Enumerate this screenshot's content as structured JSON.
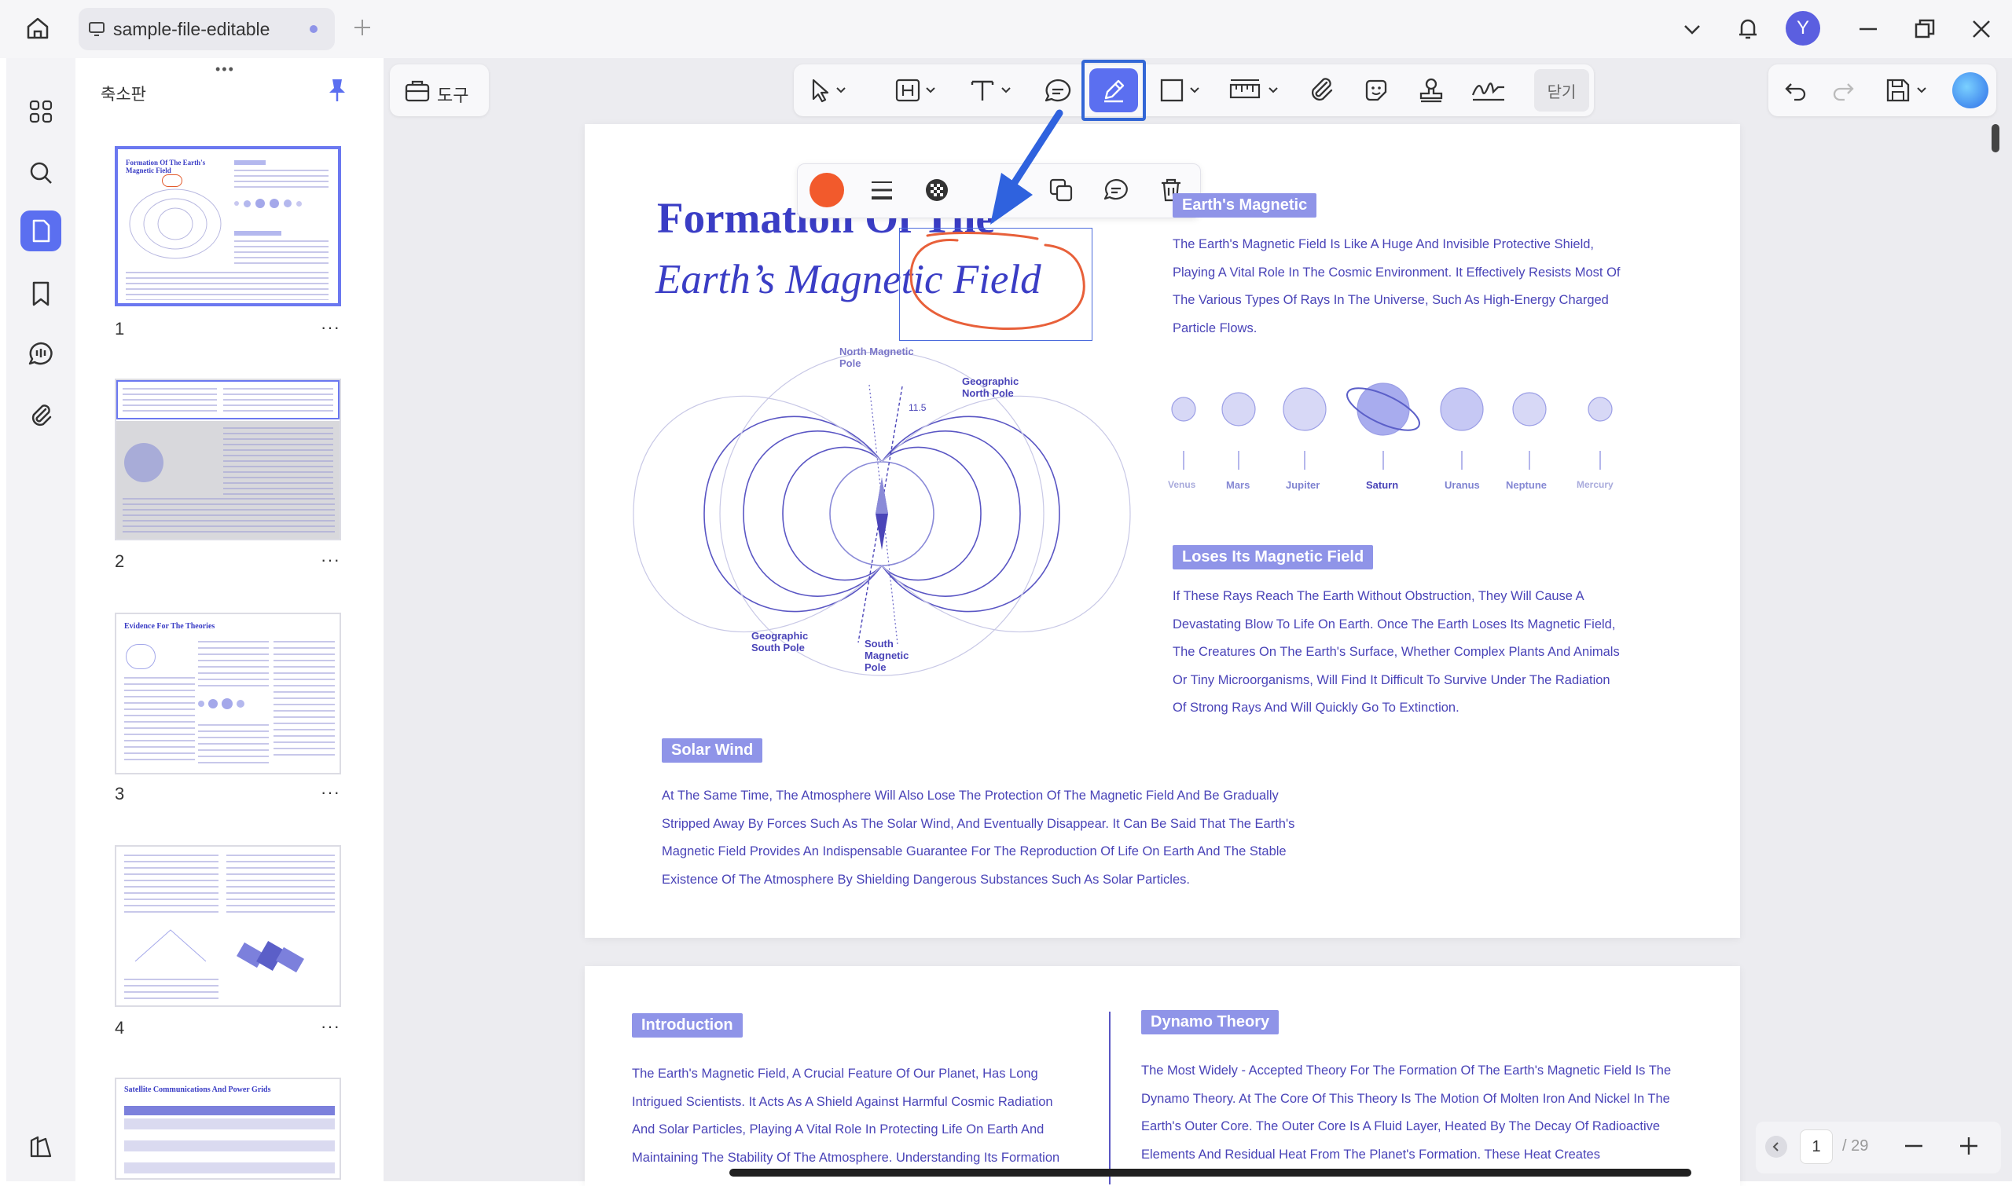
{
  "titlebar": {
    "tab_title": "sample-file-editable",
    "avatar_letter": "Y"
  },
  "thumbnails": {
    "panel_title": "축소판",
    "pages": [
      {
        "number": "1",
        "more": "···",
        "heading": "Formation Of The Earth's Magnetic Field"
      },
      {
        "number": "2",
        "more": "···"
      },
      {
        "number": "3",
        "more": "···",
        "heading": "Evidence For The Theories"
      },
      {
        "number": "4",
        "more": "···"
      },
      {
        "heading": "Satellite Communications And Power Grids"
      }
    ]
  },
  "toolbar": {
    "tools_label": "도구",
    "close_label": "닫기"
  },
  "annotation_bar": {
    "color": "#f25a2c"
  },
  "page1": {
    "title_line1": "Formation Of The",
    "title_line2": "Earth’s Magnetic Field",
    "section1_header": "Earth's Magnetic",
    "section1_text": "The Earth's Magnetic Field Is Like A Huge And Invisible Protective Shield, Playing A Vital Role In The Cosmic Environment. It Effectively Resists Most Of The Various Types Of Rays In The Universe, Such As High-Energy Charged Particle Flows.",
    "planets": [
      "Venus",
      "Mars",
      "Jupiter",
      "Saturn",
      "Uranus",
      "Neptune",
      "Mercury"
    ],
    "section2_header": "Loses Its Magnetic Field",
    "section2_text": "If These Rays Reach The Earth Without Obstruction, They Will Cause A Devastating Blow To Life On Earth. Once The Earth Loses Its Magnetic Field, The Creatures On The Earth's Surface, Whether Complex Plants And Animals Or Tiny Microorganisms, Will Find It Difficult To Survive Under The Radiation Of Strong Rays And Will Quickly Go To Extinction.",
    "diagram_labels": {
      "north_magnetic": "North Magnetic Pole",
      "geo_north": "Geographic North Pole",
      "geo_south": "Geographic South Pole",
      "south_magnetic": "South Magnetic Pole",
      "angle": "11.5"
    },
    "section3_header": "Solar Wind",
    "section3_text": "At The Same Time, The Atmosphere Will Also Lose The Protection Of The Magnetic Field And Be Gradually Stripped Away By Forces Such As The Solar Wind, And Eventually Disappear. It Can Be Said That The Earth's Magnetic Field Provides An Indispensable Guarantee For The Reproduction Of Life On Earth And The Stable Existence Of The Atmosphere By Shielding Dangerous Substances Such As Solar Particles."
  },
  "page2": {
    "intro_header": "Introduction",
    "intro_text": "The Earth's Magnetic Field, A Crucial Feature Of Our Planet, Has Long Intrigued Scientists. It Acts As A Shield Against Harmful Cosmic Radiation And Solar Particles, Playing A Vital Role In Protecting Life On Earth And Maintaining The Stability Of The Atmosphere. Understanding Its Formation",
    "dynamo_header": "Dynamo Theory",
    "dynamo_text": "The Most Widely - Accepted Theory For The Formation Of The Earth's Magnetic Field Is The Dynamo Theory. At The Core Of This Theory Is The Motion Of Molten Iron And Nickel In The Earth's Outer Core. The Outer Core Is A Fluid Layer, Heated By The Decay Of Radioactive Elements And Residual Heat From The Planet's Formation. These Heat Creates"
  },
  "pagenav": {
    "current": "1",
    "total": "/ 29"
  }
}
